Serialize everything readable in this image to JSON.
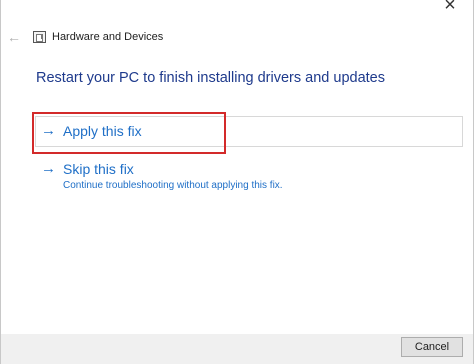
{
  "window": {
    "title": "Hardware and Devices",
    "close_glyph": "×",
    "back_glyph": "←"
  },
  "main": {
    "heading": "Restart your PC to finish installing drivers and updates",
    "options": [
      {
        "label": "Apply this fix",
        "icon": "arrow-right-icon"
      },
      {
        "label": "Skip this fix",
        "sublabel": "Continue troubleshooting without applying this fix.",
        "icon": "arrow-right-icon"
      }
    ]
  },
  "footer": {
    "cancel_label": "Cancel"
  },
  "colors": {
    "link": "#1f6fc7",
    "heading": "#1e3a8c",
    "highlight": "#d32a2a",
    "footer_bg": "#f0f0f0"
  }
}
